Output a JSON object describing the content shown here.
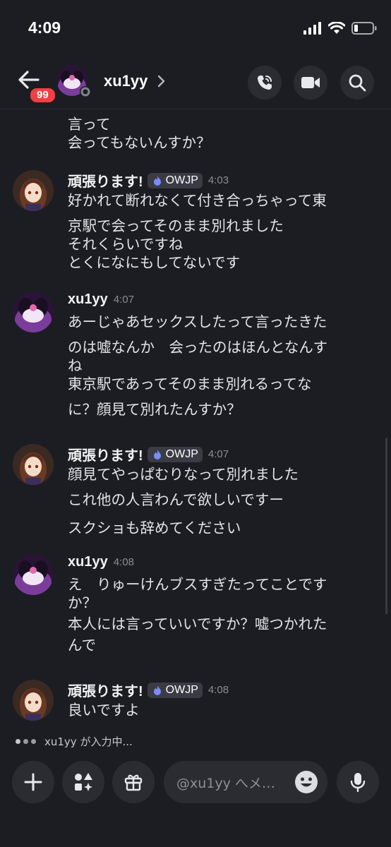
{
  "status": {
    "time": "4:09"
  },
  "header": {
    "back_badge": "99",
    "username": "xu1yy"
  },
  "messages": {
    "cont0": {
      "lines": [
        "言って",
        "会ってもないんすか？"
      ]
    },
    "m1": {
      "author": "頑張ります!",
      "tag": "OWJP",
      "time": "4:03",
      "lines": [
        "好かれて断れなくて付き合っちゃって東",
        "京駅で会ってそのまま別れました",
        "それくらいですね",
        "とくになにもしてないです"
      ]
    },
    "m2": {
      "author": "xu1yy",
      "time": "4:07",
      "lines": [
        "あーじゃあセックスしたって言ったきた",
        "のは嘘なんか　会ったのはほんとなんす",
        "ね",
        "東京駅であってそのまま別れるってな",
        "に？顔見て別れたんすか？"
      ]
    },
    "m3": {
      "author": "頑張ります!",
      "tag": "OWJP",
      "time": "4:07",
      "lines": [
        "顔見てやっぱむりなって別れました",
        "これ他の人言わんで欲しいですー",
        "スクショも辞めてください"
      ]
    },
    "m4": {
      "author": "xu1yy",
      "time": "4:08",
      "lines": [
        "え　りゅーけんブスすぎたってことです",
        "か？",
        "本人には言っていいですか？嘘つかれた",
        "んで"
      ]
    },
    "m5": {
      "author": "頑張ります!",
      "tag": "OWJP",
      "time": "4:08",
      "lines": [
        "良いですよ"
      ]
    }
  },
  "typing": {
    "text": "xu1yy が入力中..."
  },
  "composer": {
    "placeholder": "@xu1yy へメ…"
  },
  "colors": {
    "background": "#1c1d22",
    "badge": "#f23f43",
    "tag_bg": "#3a3b44",
    "button_bg": "#2a2c32"
  }
}
